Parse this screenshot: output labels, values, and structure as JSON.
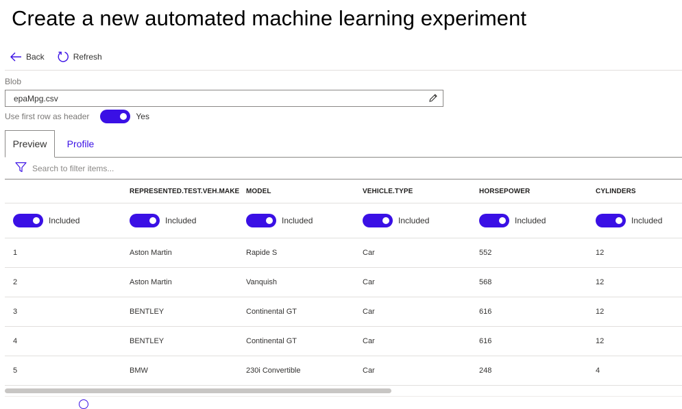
{
  "page": {
    "title": "Create a new automated machine learning experiment"
  },
  "toolbar": {
    "back_label": "Back",
    "refresh_label": "Refresh",
    "icons": [
      "arrow-left-icon",
      "refresh-icon"
    ]
  },
  "blob": {
    "label": "Blob",
    "value": "epaMpg.csv",
    "icon": "pencil-icon"
  },
  "header_toggle": {
    "label": "Use first row as header",
    "state": "Yes",
    "on": true
  },
  "tabs": [
    {
      "label": "Preview",
      "active": true
    },
    {
      "label": "Profile",
      "active": false
    }
  ],
  "filter": {
    "placeholder": "Search to filter items...",
    "icon": "filter-icon"
  },
  "table": {
    "columns": [
      "",
      "REPRESENTED.TEST.VEH.MAKE",
      "MODEL",
      "VEHICLE.TYPE",
      "HORSEPOWER",
      "CYLINDERS"
    ],
    "include_label": "Included",
    "rows": [
      [
        "1",
        "Aston Martin",
        "Rapide S",
        "Car",
        "552",
        "12"
      ],
      [
        "2",
        "Aston Martin",
        "Vanquish",
        "Car",
        "568",
        "12"
      ],
      [
        "3",
        "BENTLEY",
        "Continental GT",
        "Car",
        "616",
        "12"
      ],
      [
        "4",
        "BENTLEY",
        "Continental GT",
        "Car",
        "616",
        "12"
      ],
      [
        "5",
        "BMW",
        "230i Convertible",
        "Car",
        "248",
        "4"
      ]
    ]
  },
  "colors": {
    "accent": "#3a10e5",
    "text": "#323130",
    "muted": "#797775",
    "border": "#8a8886",
    "row_divider": "#e1dfdd"
  }
}
